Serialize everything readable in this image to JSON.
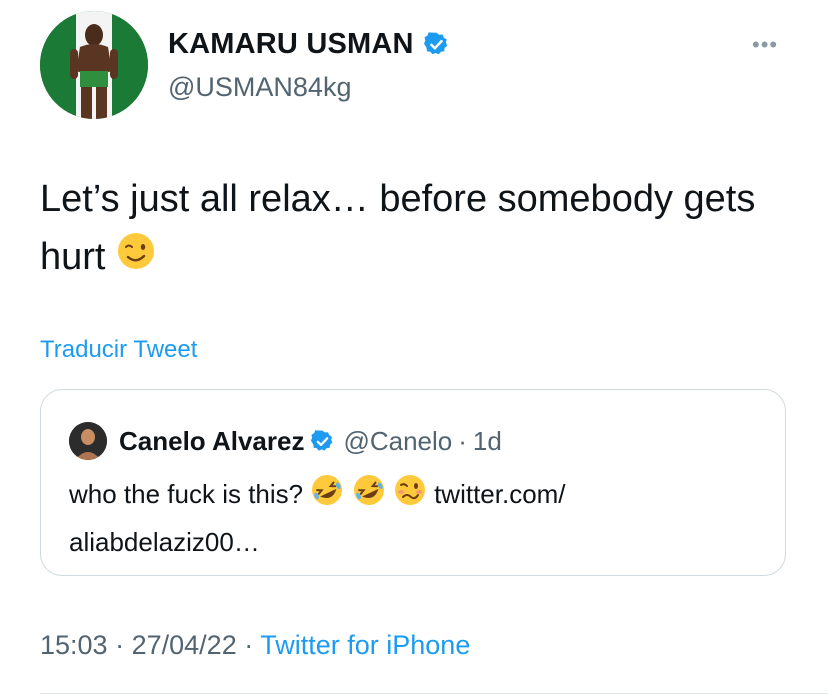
{
  "author": {
    "name": "KAMARU USMAN",
    "handle": "@USMAN84kg",
    "verified": true
  },
  "more_icon": "more-dots-icon",
  "tweet": {
    "text": "Let’s just all relax… before somebody gets hurt",
    "emoji": "winking-face"
  },
  "translate_label": "Traducir Tweet",
  "quoted_tweet": {
    "name": "Canelo Alvarez",
    "handle": "@Canelo",
    "separator": "·",
    "time": "1d",
    "text": "who the fuck is this?",
    "emojis": [
      "rolling-on-floor-laughing",
      "rolling-on-floor-laughing",
      "woozy-face"
    ],
    "link_text": "twitter.com/ aliabdelaziz00…"
  },
  "footer": {
    "time": "15:03",
    "sep1": "·",
    "date": "27/04/22",
    "sep2": "·",
    "source": "Twitter for iPhone"
  },
  "colors": {
    "link": "#1d9bf0",
    "secondary_text": "#536471",
    "verified_badge": "#1d9bf0",
    "border": "#cfd9de"
  }
}
